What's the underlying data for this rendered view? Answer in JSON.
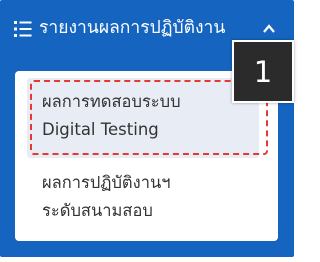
{
  "header": {
    "title": "รายงานผลการปฏิบัติงาน",
    "menu_icon": "list-icon",
    "collapse_icon": "chevron-up-icon"
  },
  "menu": {
    "items": [
      {
        "line1": "ผลการทดสอบระบบ",
        "line2": "Digital Testing",
        "active": true
      },
      {
        "line1": "ผลการปฏิบัติงานฯ",
        "line2": "ระดับสนามสอบ",
        "active": false
      }
    ]
  },
  "annotation": {
    "step_number": "1",
    "highlight_color": "#e53935"
  },
  "colors": {
    "panel_bg": "#1565c0",
    "active_item_bg": "#e8ecf4",
    "badge_bg": "#2b2b2b"
  }
}
